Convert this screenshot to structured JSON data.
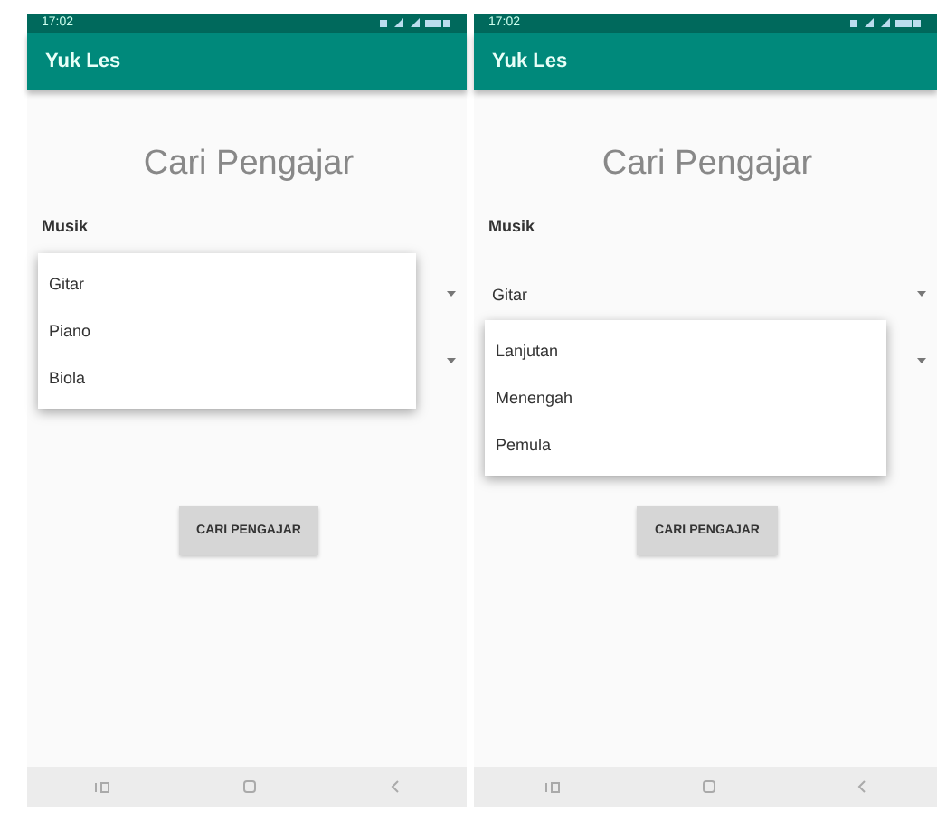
{
  "screens": [
    {
      "status_bar": {
        "time": "17:02"
      },
      "app_title": "Yuk Les",
      "heading": "Cari Pengajar",
      "label": "Musik",
      "spinners": [
        {
          "open": true,
          "options": [
            "Gitar",
            "Piano",
            "Biola"
          ]
        },
        {
          "open": false
        }
      ],
      "button": "CARI PENGAJAR"
    },
    {
      "status_bar": {
        "time": "17:02"
      },
      "app_title": "Yuk Les",
      "heading": "Cari Pengajar",
      "label": "Musik",
      "spinners": [
        {
          "open": false,
          "value": "Gitar"
        },
        {
          "open": true,
          "options": [
            "Lanjutan",
            "Menengah",
            "Pemula"
          ]
        }
      ],
      "button": "CARI PENGAJAR"
    }
  ]
}
